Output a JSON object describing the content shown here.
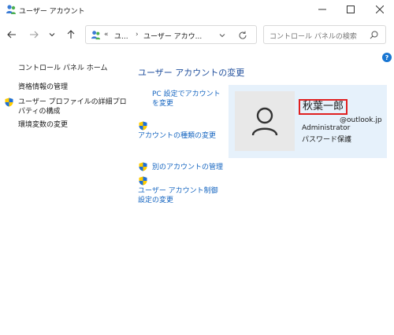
{
  "window": {
    "title": "ユーザー アカウント"
  },
  "address_bar": {
    "chevron": "«",
    "segment1": "ユ...",
    "separator": "›",
    "segment2": "ユーザー アカウ..."
  },
  "search": {
    "placeholder": "コントロール パネルの検索"
  },
  "help": {
    "label": "?"
  },
  "left_pane": {
    "home": "コントロール パネル ホーム",
    "links": [
      "資格情報の管理",
      "ユーザー プロファイルの詳細プロパティの構成",
      "環境変数の変更"
    ]
  },
  "main": {
    "heading": "ユーザー アカウントの変更",
    "tasks": {
      "pc_settings": "PC 設定でアカウントを変更",
      "change_type": "アカウントの種類の変更",
      "manage_other": "別のアカウントの管理",
      "uac": "ユーザー アカウント制御設定の変更"
    }
  },
  "user": {
    "name": "秋葉一郎",
    "email": "@outlook.jp",
    "role": "Administrator",
    "password_status": "パスワード保護"
  },
  "colors": {
    "link": "#1565c0",
    "heading": "#1f4e9c",
    "card_bg": "#e6f1fb",
    "highlight": "#e02020"
  }
}
